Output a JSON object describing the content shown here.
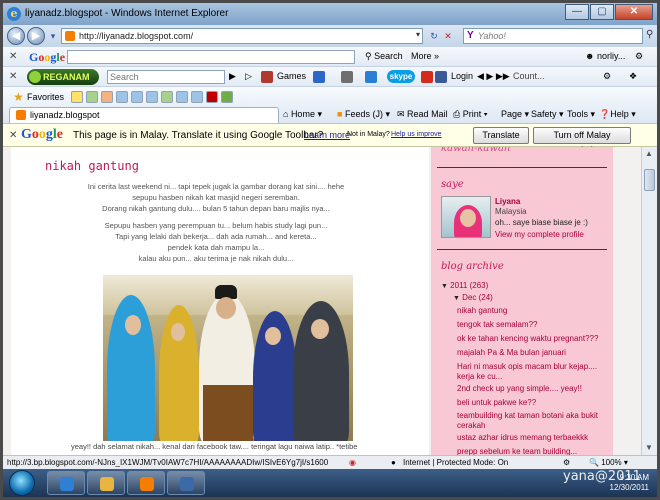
{
  "window": {
    "title": "liyanadz.blogspot - Windows Internet Explorer"
  },
  "address": {
    "url": "http://liyanadz.blogspot.com/",
    "search_placeholder": "Yahoo!",
    "search_brand": "Y"
  },
  "google_toolbar": {
    "logo": "Google",
    "search_label": "Search",
    "more_label": "More »",
    "user_label": "norliy..."
  },
  "reganam_toolbar": {
    "logo": "REGANAM",
    "search_placeholder": "Search",
    "games_label": "Games",
    "skype_label": "skype",
    "login_label": "Login",
    "count_label": "Count..."
  },
  "favorites_bar": {
    "label": "Favorites"
  },
  "tab": {
    "label": "liyanadz.blogspot"
  },
  "command_bar": {
    "home": "Home",
    "feeds": "Feeds (J)",
    "read_mail": "Read Mail",
    "print": "Print",
    "page": "Page",
    "safety": "Safety",
    "tools": "Tools",
    "help": "Help"
  },
  "translate_bar": {
    "logo": "Google",
    "message": "This page is in Malay.  Translate it using Google Toolbar?",
    "learn_more": "Learn more",
    "not_in_malay": "Not in Malay?",
    "help_improve": "Help us improve",
    "translate_button": "Translate",
    "turn_off_button": "Turn off Malay translation"
  },
  "post": {
    "title": "nikah gantung",
    "paragraphs": [
      "Ini cerita last weekend ni... tapi tepek jugak la gambar dorang kat sini.... hehe",
      "sepupu hasben nikah kat masjid negeri seremban.",
      "Dorang nikah gantung dulu.... bulan 5 tahun depan baru majlis nya...",
      "Sepupu hasben yang perempuan tu... belum habis study lagi pun...",
      "Tapi yang lelaki dah bekerja... dah ada rumah... and kereta...",
      "pendek kata dah mampu la...",
      "kalau aku pun... aku terima je nak nikah dulu..."
    ],
    "caption": "yeay!! dah selamat nikah... kenal dari facebook taw.... teringat lagu naiwa latip.. *tetibe"
  },
  "sidebar": {
    "cut_title": "kawan-kawan",
    "about_title": "saye",
    "profile": {
      "name": "Liyana",
      "country": "Malaysia",
      "bio": "oh... saye biase biase je :)",
      "link": "View my complete profile"
    },
    "archive_title": "blog archive",
    "archive": {
      "year": "2011 (263)",
      "month": "Dec (24)",
      "posts": [
        "nikah gantung",
        "tengok tak semalam??",
        "ok ke tahan kencing waktu pregnant???",
        "majalah Pa & Ma bulan januari",
        "Hari ni masuk opis macam blur kejap.... kerja ke cu...",
        "2nd check up yang simple.... yeay!!",
        "beli untuk pakwe ke??",
        "teambuilding kat taman botani aka bukit cerakah",
        "ustaz azhar idrus memang terbaekkk",
        "prepp sebelum ke team building..."
      ]
    }
  },
  "status_bar": {
    "url": "http://3.bp.blogspot.com/-NJns_IX1WJM/Tv0IAW7c7HI/AAAAAAAADIw/ISIvE6Yg7jI/s1600",
    "zone": "Internet | Protected Mode: On",
    "zoom": "100%"
  },
  "taskbar": {
    "time": "9:30 AM",
    "date": "12/30/2011"
  },
  "watermark": "yana@2011",
  "colors": {
    "accent_pink": "#c2185b",
    "sidebar_bg": "#f8c9d4",
    "archive_link": "#a8003a"
  }
}
